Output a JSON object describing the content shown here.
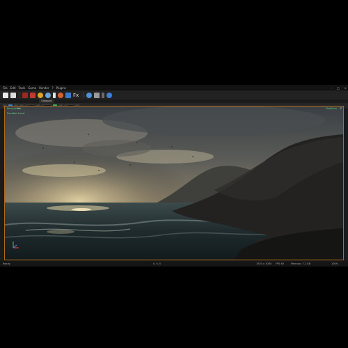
{
  "menu": [
    "File",
    "Edit",
    "Tools",
    "Game",
    "Render",
    "?",
    "Plugins"
  ],
  "window_controls": [
    "–",
    "□",
    "×"
  ],
  "toolbar_icons": [
    {
      "name": "new-file-icon",
      "color": "#e8e8e8"
    },
    {
      "name": "save-icon",
      "color": "#e8e8e8"
    },
    {
      "name": "hammer-icon",
      "color": "#c0392b"
    },
    {
      "name": "mesh-icon",
      "color": "#c0392b"
    },
    {
      "name": "material-icon",
      "color": "#e0a030"
    },
    {
      "name": "cloud-icon",
      "color": "#6aa0d8"
    },
    {
      "name": "bottle-icon",
      "color": "#e0e0e0"
    },
    {
      "name": "sphere-icon",
      "color": "#d4622c"
    },
    {
      "name": "flag-icon",
      "color": "#3a78c8"
    },
    {
      "name": "fx-icon",
      "color": "#e0e0e0"
    },
    {
      "name": "undo-icon",
      "color": "#4f8fd8"
    },
    {
      "name": "box-icon",
      "color": "#9a9a9a"
    },
    {
      "name": "grid-icon",
      "color": "#bdbdbd"
    },
    {
      "name": "globe-icon",
      "color": "#3d7fd4"
    }
  ],
  "viewport": {
    "tab_label": "Viewport",
    "mode_label": "Perspective",
    "lit_label": "Lit",
    "sub_label": "Sandbox Level",
    "right_label": "Realtime",
    "corner_glyph": "⚲",
    "grid_value": "1.0",
    "speed_value": "1",
    "snap_value": "10"
  },
  "status": {
    "left": "Ready",
    "center": "0, 0, 0",
    "fields": [
      "1920 x 1080",
      "FPS 60",
      "Memory: 7.2 GB",
      "100%"
    ]
  },
  "colors": {
    "accent": "#b06a1c",
    "label_green": "#4fd27a"
  }
}
